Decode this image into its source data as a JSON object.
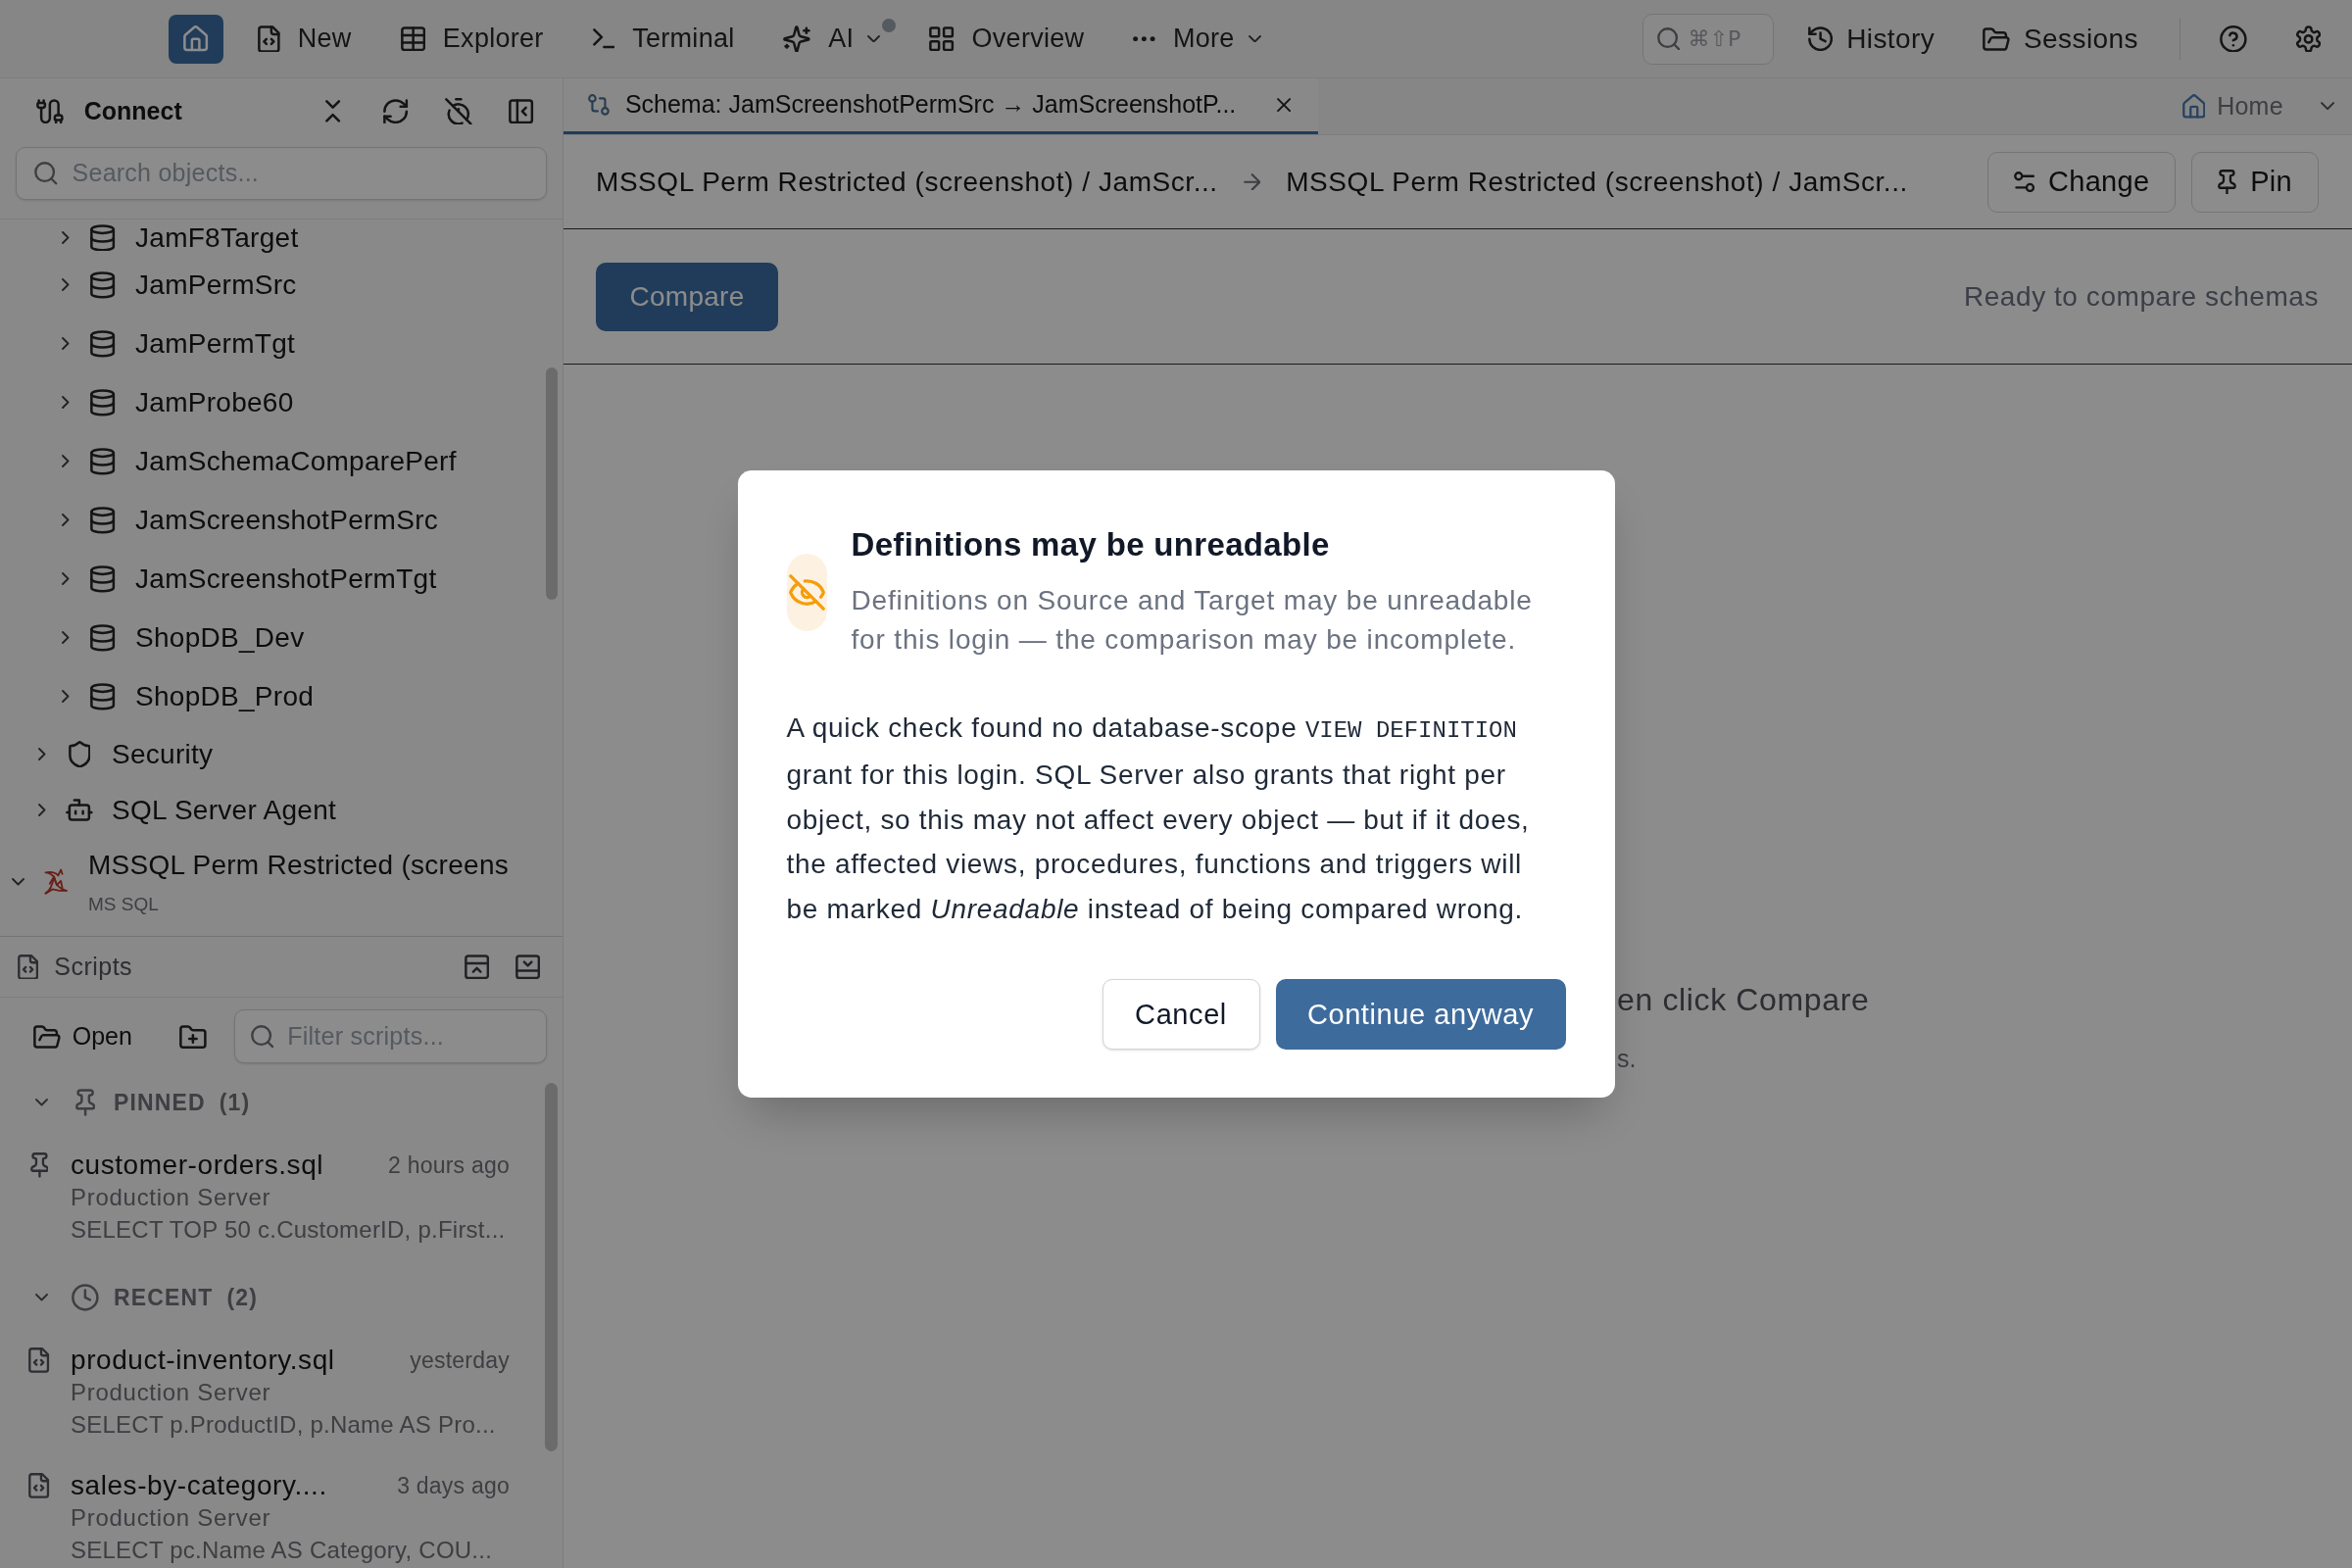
{
  "top_bar": {
    "home": {
      "selected": true
    },
    "nav": [
      {
        "label": "New",
        "selected": false,
        "has_menu": false,
        "notification": false
      },
      {
        "label": "Explorer",
        "selected": false,
        "has_menu": false,
        "notification": false
      },
      {
        "label": "Terminal",
        "selected": false,
        "has_menu": false,
        "notification": false
      },
      {
        "label": "AI",
        "selected": false,
        "has_menu": true,
        "notification": true
      },
      {
        "label": "Overview",
        "selected": false,
        "has_menu": false,
        "notification": false
      },
      {
        "label": "More",
        "selected": false,
        "has_menu": true,
        "notification": false
      }
    ],
    "command_search": {
      "shortcut": "⌘⇧P"
    },
    "actions": [
      {
        "label": "History"
      },
      {
        "label": "Sessions"
      }
    ]
  },
  "sidebar": {
    "explorer": {
      "title": "Connect",
      "search": {
        "placeholder": "Search objects..."
      },
      "tree": [
        {
          "children": [
            {
              "children": [
                {
                  "label": "JamF8Target",
                  "kind": "database",
                  "expanded": false
                },
                {
                  "label": "JamPermSrc",
                  "kind": "database",
                  "expanded": false
                },
                {
                  "label": "JamPermTgt",
                  "kind": "database",
                  "expanded": false
                },
                {
                  "label": "JamProbe60",
                  "kind": "database",
                  "expanded": false
                },
                {
                  "label": "JamSchemaComparePerf",
                  "kind": "database",
                  "expanded": false
                },
                {
                  "label": "JamScreenshotPermSrc",
                  "kind": "database",
                  "expanded": false
                },
                {
                  "label": "JamScreenshotPermTgt",
                  "kind": "database",
                  "expanded": false
                },
                {
                  "label": "ShopDB_Dev",
                  "kind": "database",
                  "expanded": false
                },
                {
                  "label": "ShopDB_Prod",
                  "kind": "database",
                  "expanded": false
                }
              ]
            },
            {
              "label": "Security",
              "kind": "security",
              "expanded": false
            },
            {
              "label": "SQL Server Agent",
              "kind": "agent",
              "expanded": false
            }
          ]
        },
        {
          "label": "MSSQL Perm Restricted (screens",
          "sublabel": "MS SQL",
          "kind": "server",
          "expanded": true
        }
      ]
    },
    "scripts": {
      "title": "Scripts",
      "open_label": "Open",
      "filter": {
        "placeholder": "Filter scripts..."
      },
      "sections": [
        {
          "kind": "pinned",
          "label": "PINNED",
          "count": "(1)",
          "expanded": true,
          "items": [
            {
              "name": "customer-orders.sql",
              "time": "2 hours ago",
              "server": "Production Server",
              "preview": "SELECT TOP 50 c.CustomerID, p.First..."
            }
          ]
        },
        {
          "kind": "recent",
          "label": "RECENT",
          "count": "(2)",
          "expanded": true,
          "items": [
            {
              "name": "product-inventory.sql",
              "time": "yesterday",
              "server": "Production Server",
              "preview": "SELECT p.ProductID, p.Name AS Pro..."
            },
            {
              "name": "sales-by-category....",
              "time": "3 days ago",
              "server": "Production Server",
              "preview": "SELECT pc.Name AS Category, COU..."
            }
          ]
        }
      ]
    }
  },
  "tabs": [
    {
      "label": "Schema: JamScreenshotPermSrc → JamScreenshotP...",
      "selected": true
    }
  ],
  "workspace": {
    "label": "Home"
  },
  "compare_header": {
    "source": "MSSQL Perm Restricted (screenshot) / JamScr...",
    "target": "MSSQL Perm Restricted (screenshot) / JamScr...",
    "buttons": [
      {
        "label": "Change"
      },
      {
        "label": "Pin"
      }
    ]
  },
  "toolbar": {
    "compare_button": "Compare",
    "status": "Ready to compare schemas"
  },
  "empty_state": {
    "lines": [
      "en click Compare",
      "s."
    ]
  },
  "dialog": {
    "title": "Definitions may be unreadable",
    "subtitle": "Definitions on Source and Target may be unreadable for this login — the comparison may be incomplete.",
    "message": [
      {
        "kind": "text",
        "text": "A quick check found no database-scope "
      },
      {
        "kind": "code",
        "text": "VIEW DEFINITION"
      },
      {
        "kind": "text",
        "text": " grant for this login. SQL Server also grants that right per object, so this may not affect every object — but if it does, the affected views, procedures, functions and triggers will be marked *Unreadable* instead of being compared wrong."
      }
    ],
    "buttons": [
      {
        "label": "Cancel",
        "kind": "secondary"
      },
      {
        "label": "Continue anyway",
        "kind": "primary"
      }
    ]
  }
}
